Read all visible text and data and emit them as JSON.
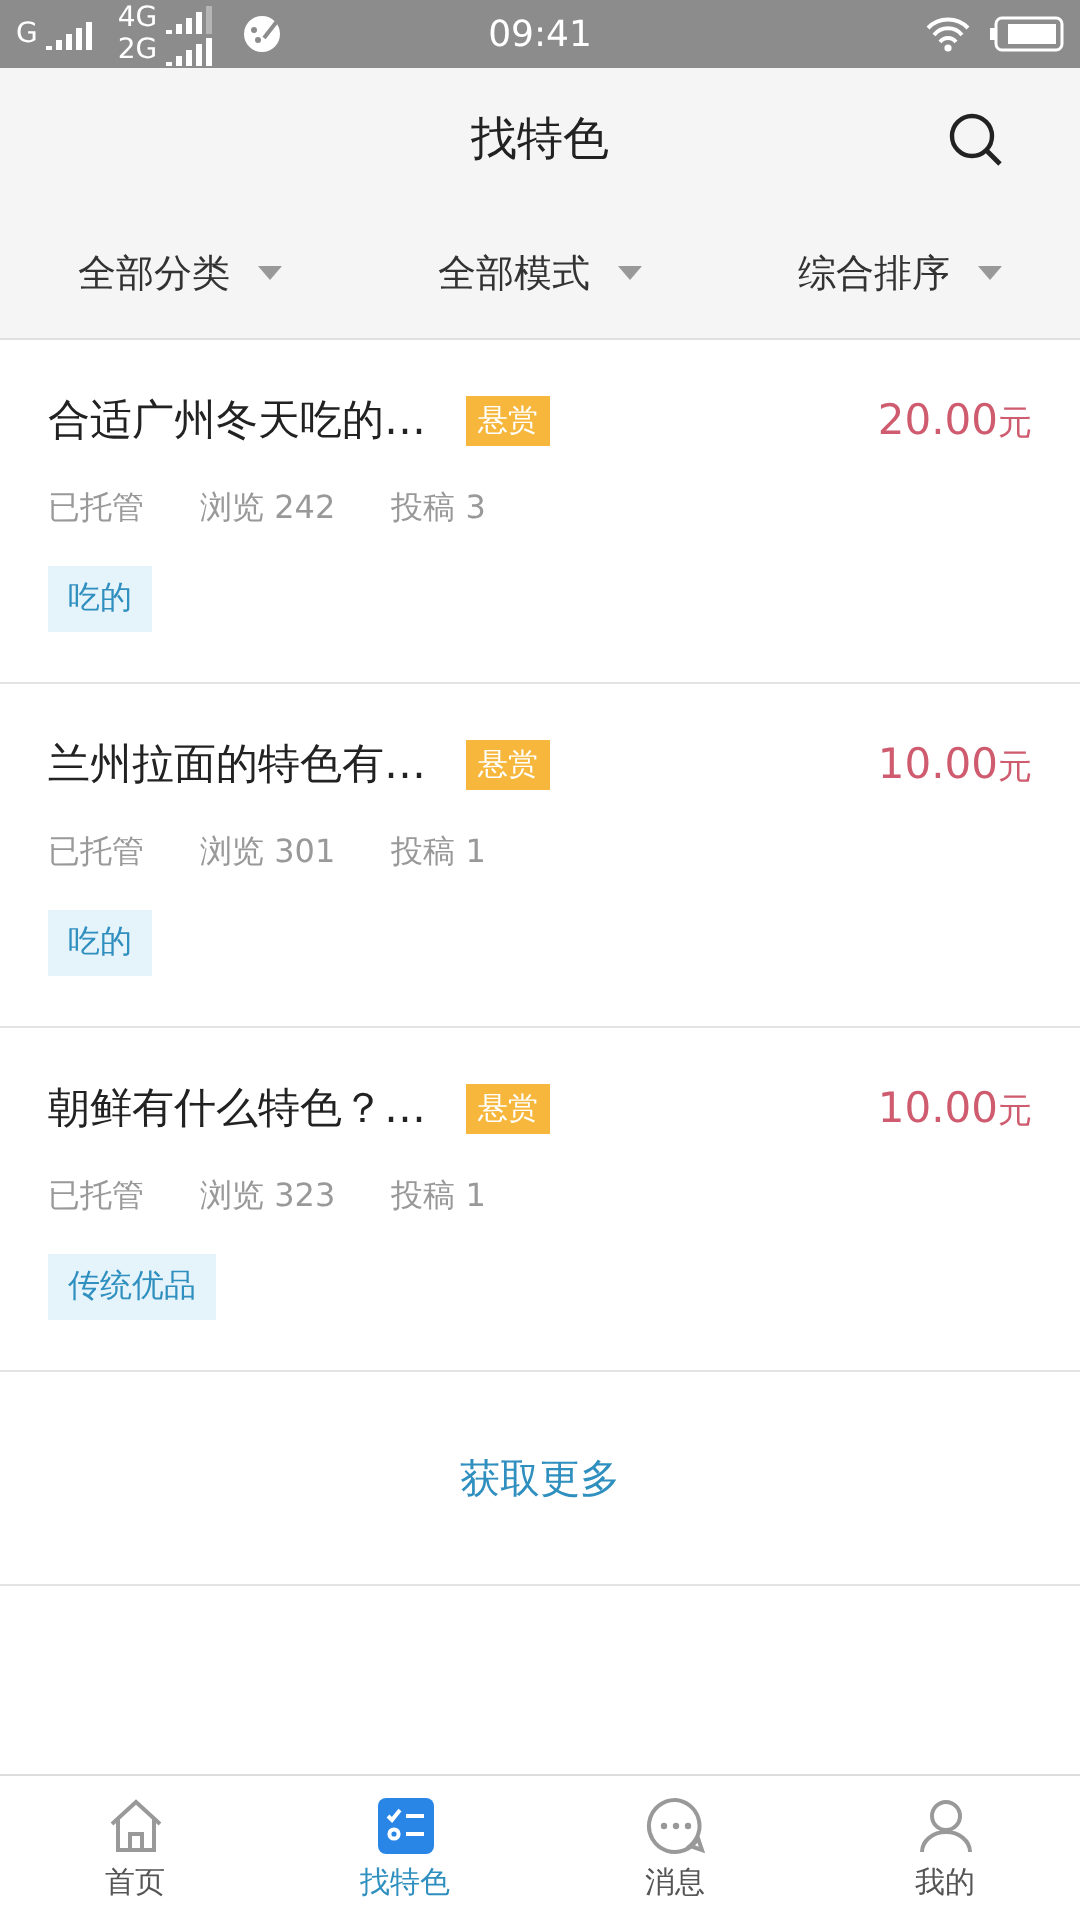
{
  "status_bar": {
    "network_1": "G",
    "network_2": "4G",
    "network_3": "2G",
    "time": "09:41"
  },
  "header": {
    "title": "找特色"
  },
  "filters": [
    {
      "label": "全部分类"
    },
    {
      "label": "全部模式"
    },
    {
      "label": "综合排序"
    }
  ],
  "posts": [
    {
      "title": "合适广州冬天吃的…",
      "badge": "悬赏",
      "price": "20.00",
      "currency": "元",
      "status": "已托管",
      "views": "浏览 242",
      "submissions": "投稿 3",
      "tag": "吃的"
    },
    {
      "title": "兰州拉面的特色有…",
      "badge": "悬赏",
      "price": "10.00",
      "currency": "元",
      "status": "已托管",
      "views": "浏览 301",
      "submissions": "投稿 1",
      "tag": "吃的"
    },
    {
      "title": "朝鲜有什么特色？…",
      "badge": "悬赏",
      "price": "10.00",
      "currency": "元",
      "status": "已托管",
      "views": "浏览 323",
      "submissions": "投稿 1",
      "tag": "传统优品"
    }
  ],
  "load_more": "获取更多",
  "tab_bar": [
    {
      "kind": "home",
      "label": "首页",
      "selected": false
    },
    {
      "kind": "list",
      "label": "找特色",
      "selected": true
    },
    {
      "kind": "message",
      "label": "消息",
      "selected": false
    },
    {
      "kind": "profile",
      "label": "我的",
      "selected": false
    }
  ]
}
